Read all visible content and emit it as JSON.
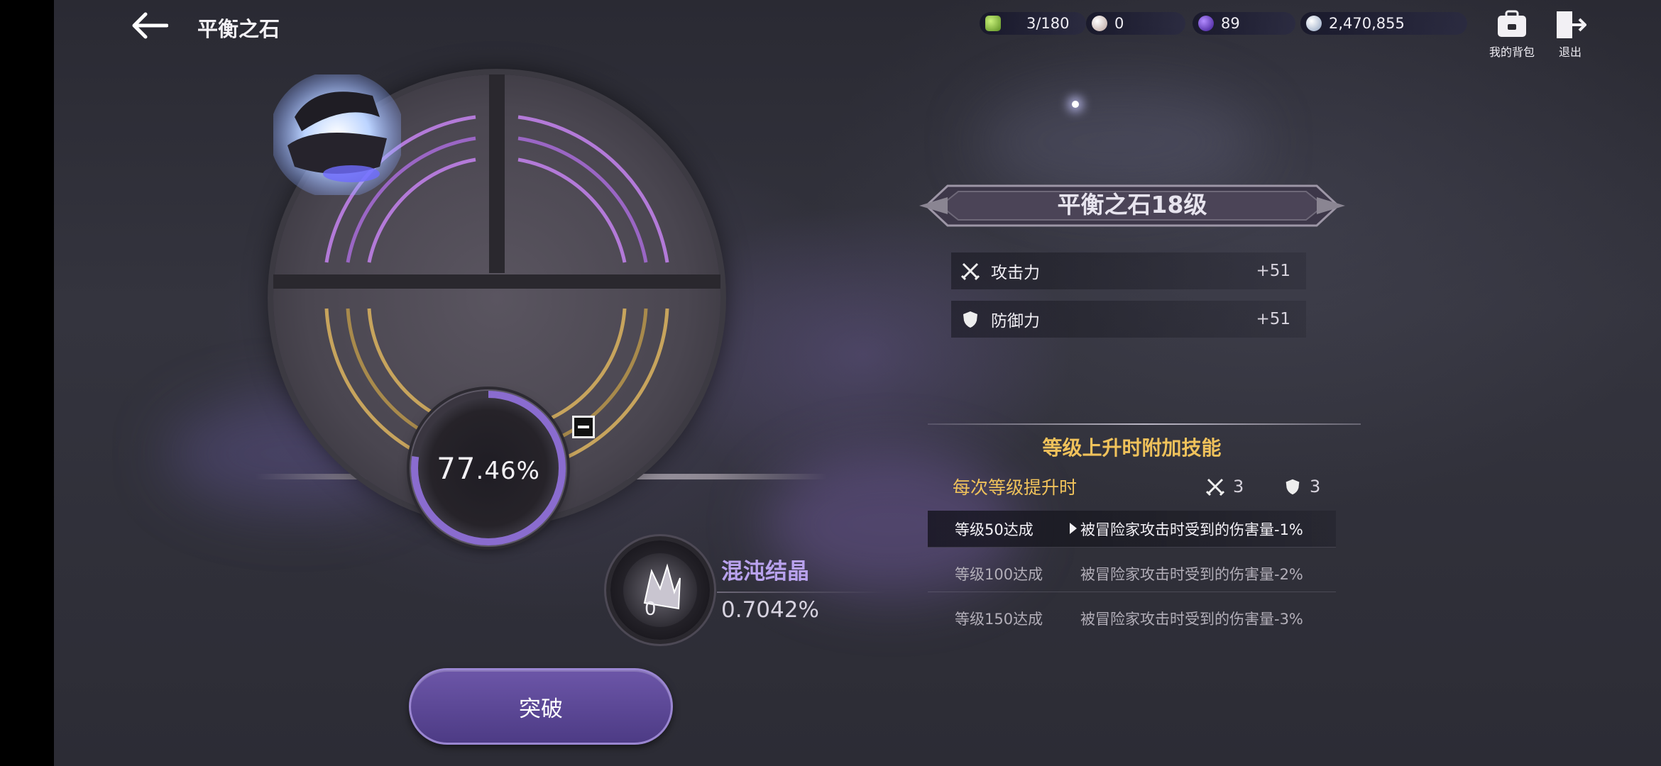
{
  "header": {
    "title": "平衡之石",
    "back_icon": "arrow-left-icon"
  },
  "resources": [
    {
      "name": "green-stone",
      "value": "3/180",
      "color": "#7fbf3a"
    },
    {
      "name": "pearl",
      "value": "0",
      "color": "#e8dcd8"
    },
    {
      "name": "purple-orb",
      "value": "89",
      "color": "#6b3fd6"
    },
    {
      "name": "silver-coin",
      "value": "2,470,855",
      "color": "#cfd7e6"
    }
  ],
  "top_tools": {
    "bag_label": "我的背包",
    "exit_label": "退出"
  },
  "emblem": {
    "progress_int": "77",
    "progress_dec": ".46%",
    "progress_value": 77.46
  },
  "crystal": {
    "name": "混沌结晶",
    "count": "0",
    "rate": "0.7042%"
  },
  "breakthrough_label": "突破",
  "level_panel": {
    "title": "平衡之石18级",
    "stats": [
      {
        "name": "攻击力",
        "value": "+51",
        "icon": "crossed-swords-icon"
      },
      {
        "name": "防御力",
        "value": "+51",
        "icon": "shield-icon"
      }
    ]
  },
  "skill_section": {
    "title": "等级上升时附加技能",
    "per_level_label": "每次等级提升时",
    "per_level_attack": "3",
    "per_level_defense": "3",
    "milestones": [
      {
        "level": "等级50达成",
        "desc": "被冒险家攻击时受到的伤害量-1%"
      },
      {
        "level": "等级100达成",
        "desc": "被冒险家攻击时受到的伤害量-2%"
      },
      {
        "level": "等级150达成",
        "desc": "被冒险家攻击时受到的伤害量-3%"
      }
    ]
  }
}
